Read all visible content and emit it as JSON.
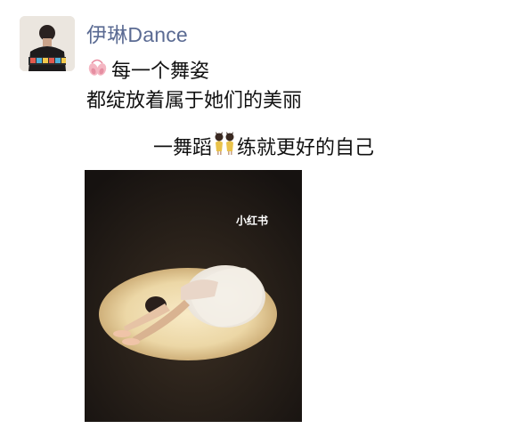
{
  "post": {
    "author_name": "伊琳Dance",
    "line1_text": "每一个舞姿",
    "line2_text": "都绽放着属于她们的美丽",
    "line3_before": "一舞蹈",
    "line3_after": "练就更好的自己",
    "icons": {
      "line1_emoji": "ballet-shoes-icon",
      "line3_emoji": "dancing-girls-icon"
    }
  },
  "image": {
    "watermark": "小红书"
  }
}
